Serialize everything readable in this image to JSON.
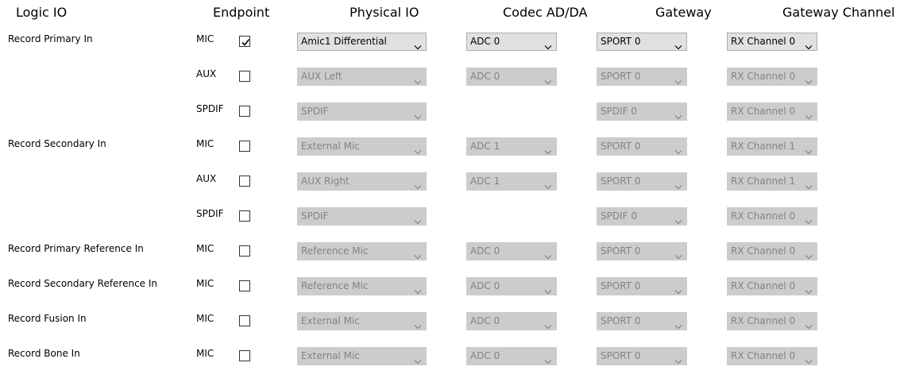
{
  "headers": {
    "logic": "Logic IO",
    "endpoint": "Endpoint",
    "physical": "Physical IO",
    "codec": "Codec AD/DA",
    "gateway": "Gateway",
    "gateway_channel": "Gateway Channel"
  },
  "rows": [
    {
      "logic": "Record Primary In",
      "endpoint": "MIC",
      "checked": true,
      "physical": "Amic1 Differential",
      "codec": "ADC 0",
      "gateway": "SPORT 0",
      "channel": "RX Channel 0",
      "enabled": true
    },
    {
      "logic": "",
      "endpoint": "AUX",
      "checked": false,
      "physical": "AUX Left",
      "codec": "ADC 0",
      "gateway": "SPORT 0",
      "channel": "RX Channel 0",
      "enabled": false
    },
    {
      "logic": "",
      "endpoint": "SPDIF",
      "checked": false,
      "physical": "SPDIF",
      "codec": "",
      "gateway": "SPDIF 0",
      "channel": "RX Channel 0",
      "enabled": false
    },
    {
      "logic": "Record Secondary In",
      "endpoint": "MIC",
      "checked": false,
      "physical": "External Mic",
      "codec": "ADC 1",
      "gateway": "SPORT 0",
      "channel": "RX Channel 1",
      "enabled": false
    },
    {
      "logic": "",
      "endpoint": "AUX",
      "checked": false,
      "physical": "AUX Right",
      "codec": "ADC 1",
      "gateway": "SPORT 0",
      "channel": "RX Channel 1",
      "enabled": false
    },
    {
      "logic": "",
      "endpoint": "SPDIF",
      "checked": false,
      "physical": "SPDIF",
      "codec": "",
      "gateway": "SPDIF 0",
      "channel": "RX Channel 0",
      "enabled": false
    },
    {
      "logic": "Record Primary Reference In",
      "endpoint": "MIC",
      "checked": false,
      "physical": "Reference Mic",
      "codec": "ADC 0",
      "gateway": "SPORT 0",
      "channel": "RX Channel 0",
      "enabled": false
    },
    {
      "logic": "Record Secondary Reference In",
      "endpoint": "MIC",
      "checked": false,
      "physical": "Reference Mic",
      "codec": "ADC 0",
      "gateway": "SPORT 0",
      "channel": "RX Channel 0",
      "enabled": false
    },
    {
      "logic": "Record Fusion In",
      "endpoint": "MIC",
      "checked": false,
      "physical": "External Mic",
      "codec": "ADC 0",
      "gateway": "SPORT 0",
      "channel": "RX Channel 0",
      "enabled": false
    },
    {
      "logic": "Record Bone In",
      "endpoint": "MIC",
      "checked": false,
      "physical": "External Mic",
      "codec": "ADC 0",
      "gateway": "SPORT 0",
      "channel": "RX Channel 0",
      "enabled": false
    }
  ],
  "colors": {
    "enabled_bg": "#e1e1e1",
    "disabled_bg": "#cccccc",
    "disabled_text": "#838383"
  },
  "icons": {
    "dropdown": "chevron-down-icon",
    "check": "checkmark-icon"
  }
}
